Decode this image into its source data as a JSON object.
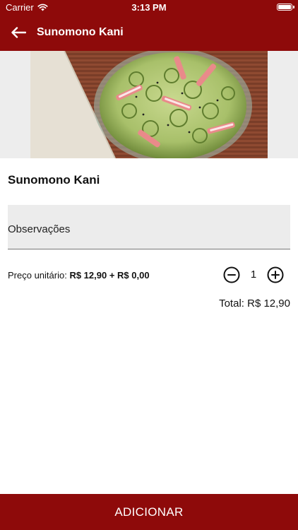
{
  "status_bar": {
    "carrier": "Carrier",
    "time": "3:13 PM",
    "wifi_icon": "wifi-icon",
    "battery_icon": "battery-icon",
    "battery_level": 1.0
  },
  "header": {
    "title": "Sunomono Kani",
    "back_icon": "arrow-left-icon",
    "background_color": "#8e0a0a"
  },
  "product": {
    "name": "Sunomono Kani",
    "image_subject": "bowl of cucumber salad with crab sticks"
  },
  "notes": {
    "placeholder": "Observações",
    "value": ""
  },
  "price": {
    "label": "Preço unitário:",
    "values": "R$ 12,90 + R$ 0,00"
  },
  "quantity": {
    "value": "1",
    "minus_icon": "minus-circle-icon",
    "plus_icon": "plus-circle-icon"
  },
  "total": {
    "text": "Total: R$ 12,90"
  },
  "actions": {
    "add_label": "ADICIONAR",
    "accent_color": "#8e0a0a"
  }
}
